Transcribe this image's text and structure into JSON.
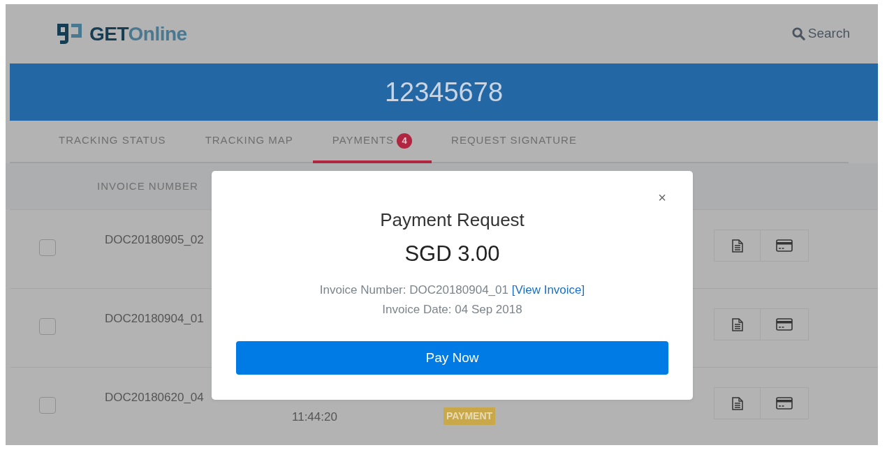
{
  "header": {
    "logo": {
      "dark": "GET",
      "light": "Online"
    },
    "search": "Search"
  },
  "shipment": {
    "number": "12345678"
  },
  "tabs": [
    {
      "label": "TRACKING STATUS",
      "selected": false
    },
    {
      "label": "TRACKING MAP",
      "selected": false
    },
    {
      "label": "PAYMENTS",
      "selected": true,
      "badge": "4"
    },
    {
      "label": "REQUEST SIGNATURE",
      "selected": false
    }
  ],
  "table": {
    "columns": [
      "INVOICE NUMBER"
    ],
    "rows": [
      {
        "checked": false,
        "invoice_number": "DOC20180905_02"
      },
      {
        "checked": false,
        "invoice_number": "DOC20180904_01"
      },
      {
        "checked": false,
        "invoice_number": "DOC20180620_04",
        "time": "11:44:20",
        "status": "PAYMENT"
      }
    ]
  },
  "modal": {
    "title": "Payment Request",
    "amount": "SGD 3.00",
    "invoice_number": "Invoice Number: DOC20180904_01",
    "view_invoice": "[View Invoice]",
    "invoice_date": "Invoice Date: 04 Sep 2018",
    "button": "Pay Now",
    "close": "×"
  }
}
